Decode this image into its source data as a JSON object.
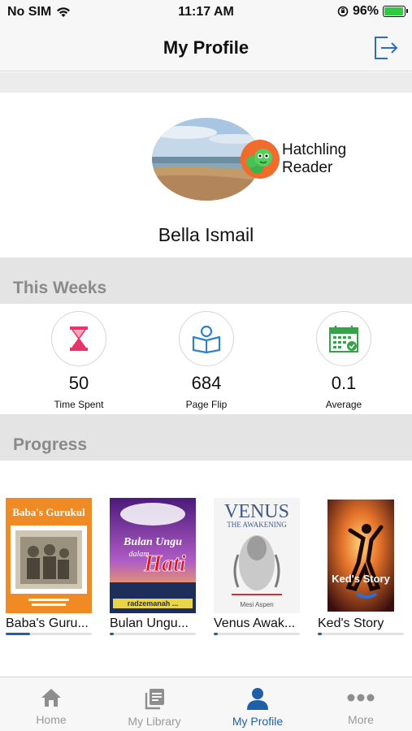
{
  "status_bar": {
    "carrier": "No SIM",
    "time": "11:17 AM",
    "battery": "96%",
    "battery_level": 0.96
  },
  "nav": {
    "title": "My Profile",
    "logout_icon": "logout-icon"
  },
  "profile": {
    "name": "Bella Ismail",
    "level_line1": "Hatchling",
    "level_line2": "Reader",
    "badge_icon": "caterpillar-badge-icon"
  },
  "stats_section": {
    "title": "This Weeks",
    "items": [
      {
        "value": "50",
        "label": "Time Spent",
        "icon": "hourglass-icon"
      },
      {
        "value": "684",
        "label": "Page Flip",
        "icon": "reader-icon"
      },
      {
        "value": "0.1",
        "label": "Average",
        "icon": "calendar-icon"
      }
    ]
  },
  "progress_section": {
    "title": "Progress",
    "books": [
      {
        "title": "Baba's Guru...",
        "progress": 0.28
      },
      {
        "title": "Bulan Ungu...",
        "progress": 0.05
      },
      {
        "title": "Venus Awak...",
        "progress": 0.05
      },
      {
        "title": "Ked's Story",
        "progress": 0.05
      }
    ],
    "covers": {
      "b1_title": "Baba's Gurukul",
      "b2_title_1": "Bulan Ungu",
      "b2_title_2": "dalam",
      "b2_title_3": "Hati",
      "b2_author": "radzemanah ...",
      "b3_title": "VENUS",
      "b3_sub": "THE AWAKENING",
      "b3_author": "Mesi Aspen",
      "b4_title": "Ked's Story"
    }
  },
  "tabs": [
    {
      "label": "Home",
      "icon": "home-icon",
      "active": false
    },
    {
      "label": "My Library",
      "icon": "library-icon",
      "active": false
    },
    {
      "label": "My Profile",
      "icon": "profile-icon",
      "active": true
    },
    {
      "label": "More",
      "icon": "more-icon",
      "active": false
    }
  ],
  "colors": {
    "accent": "#1f5fa8",
    "badge": "#ef6c2c",
    "stat_icon_1": "#e8336d",
    "stat_icon_2": "#2f7fd0",
    "stat_icon_3": "#35a34a"
  }
}
